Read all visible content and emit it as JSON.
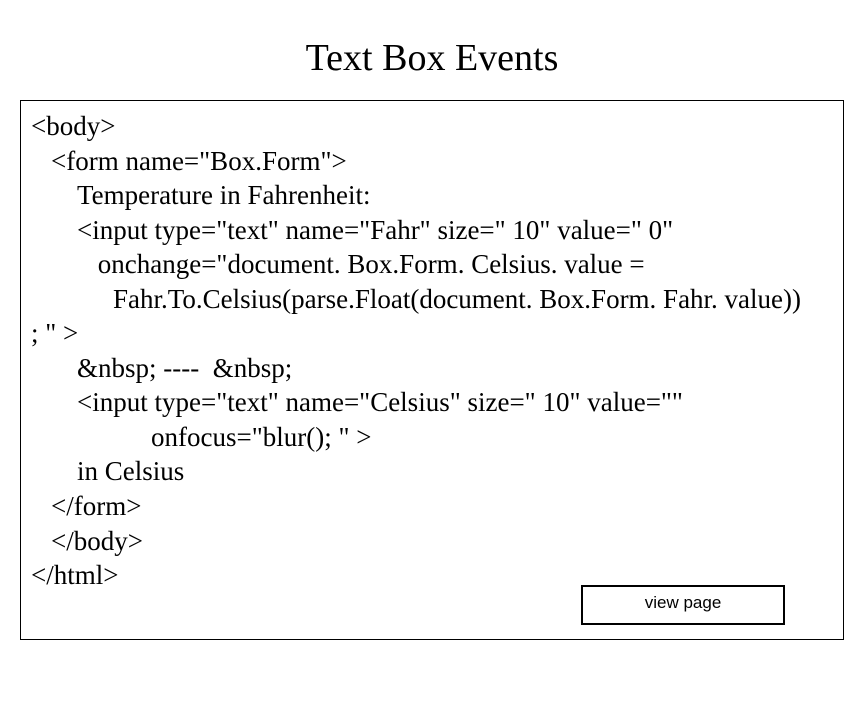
{
  "title": "Text Box Events",
  "code": {
    "l1": "<body>",
    "l2": "<form name=\"Box.Form\">",
    "l3": "Temperature in Fahrenheit:",
    "l4": "<input type=\"text\" name=\"Fahr\" size=\" 10\" value=\" 0\"",
    "l5": " onchange=\"document. Box.Form. Celsius. value =",
    "l6": "Fahr.To.Celsius(parse.Float(document. Box.Form. Fahr. value))",
    "l7": "; \" >",
    "l8": "&nbsp; ----  &nbsp;",
    "l9": "<input type=\"text\" name=\"Celsius\" size=\" 10\" value=\"\"",
    "l10": "onfocus=\"blur(); \" >",
    "l11": "in Celsius",
    "l12": "</form>",
    "l13": "</body>",
    "l14": "</html>"
  },
  "button": {
    "view_label": "view page"
  }
}
